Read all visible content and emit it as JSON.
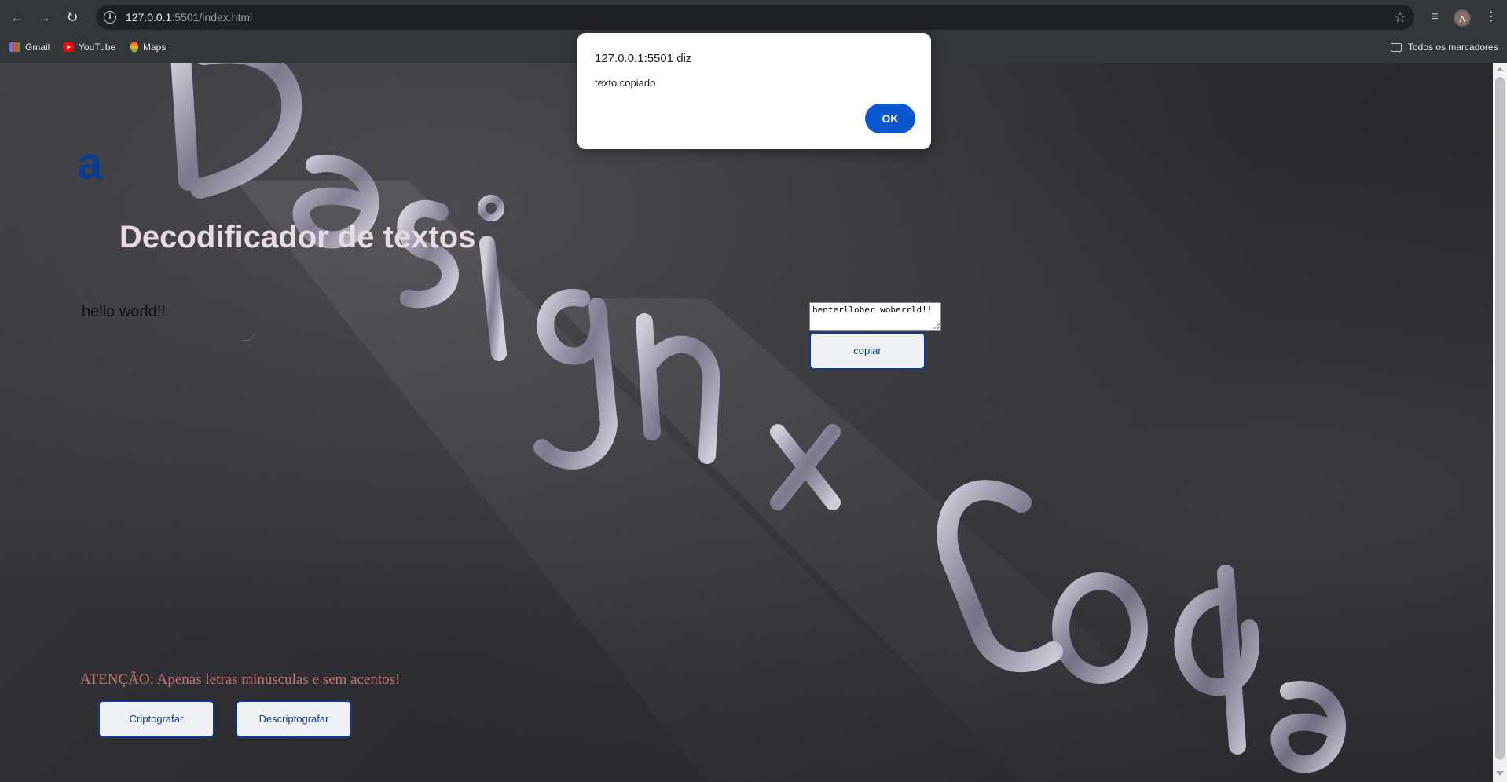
{
  "browser": {
    "url_host": "127.0.0.1",
    "url_rest": ":5501/index.html",
    "bookmarks": [
      "Gmail",
      "YouTube",
      "Maps"
    ],
    "all_bookmarks_label": "Todos os marcadores",
    "profile_initial": "A"
  },
  "page": {
    "logo_text": "a",
    "title": "Decodificador de textos",
    "input_value": "hello world!!",
    "output_value": "henterllober woberrld!!",
    "copy_label": "copiar",
    "warning": "ATENÇÃO: Apenas letras minúsculas e sem acentos!",
    "encrypt_label": "Criptografar",
    "decrypt_label": "Descriptografar",
    "background_art_text": "Design+Code"
  },
  "dialog": {
    "title": "127.0.0.1:5501 diz",
    "message": "texto copiado",
    "ok_label": "OK"
  },
  "colors": {
    "brand_blue": "#0a3d91",
    "dialog_button": "#0b57d0",
    "warning_text": "#c47272"
  }
}
